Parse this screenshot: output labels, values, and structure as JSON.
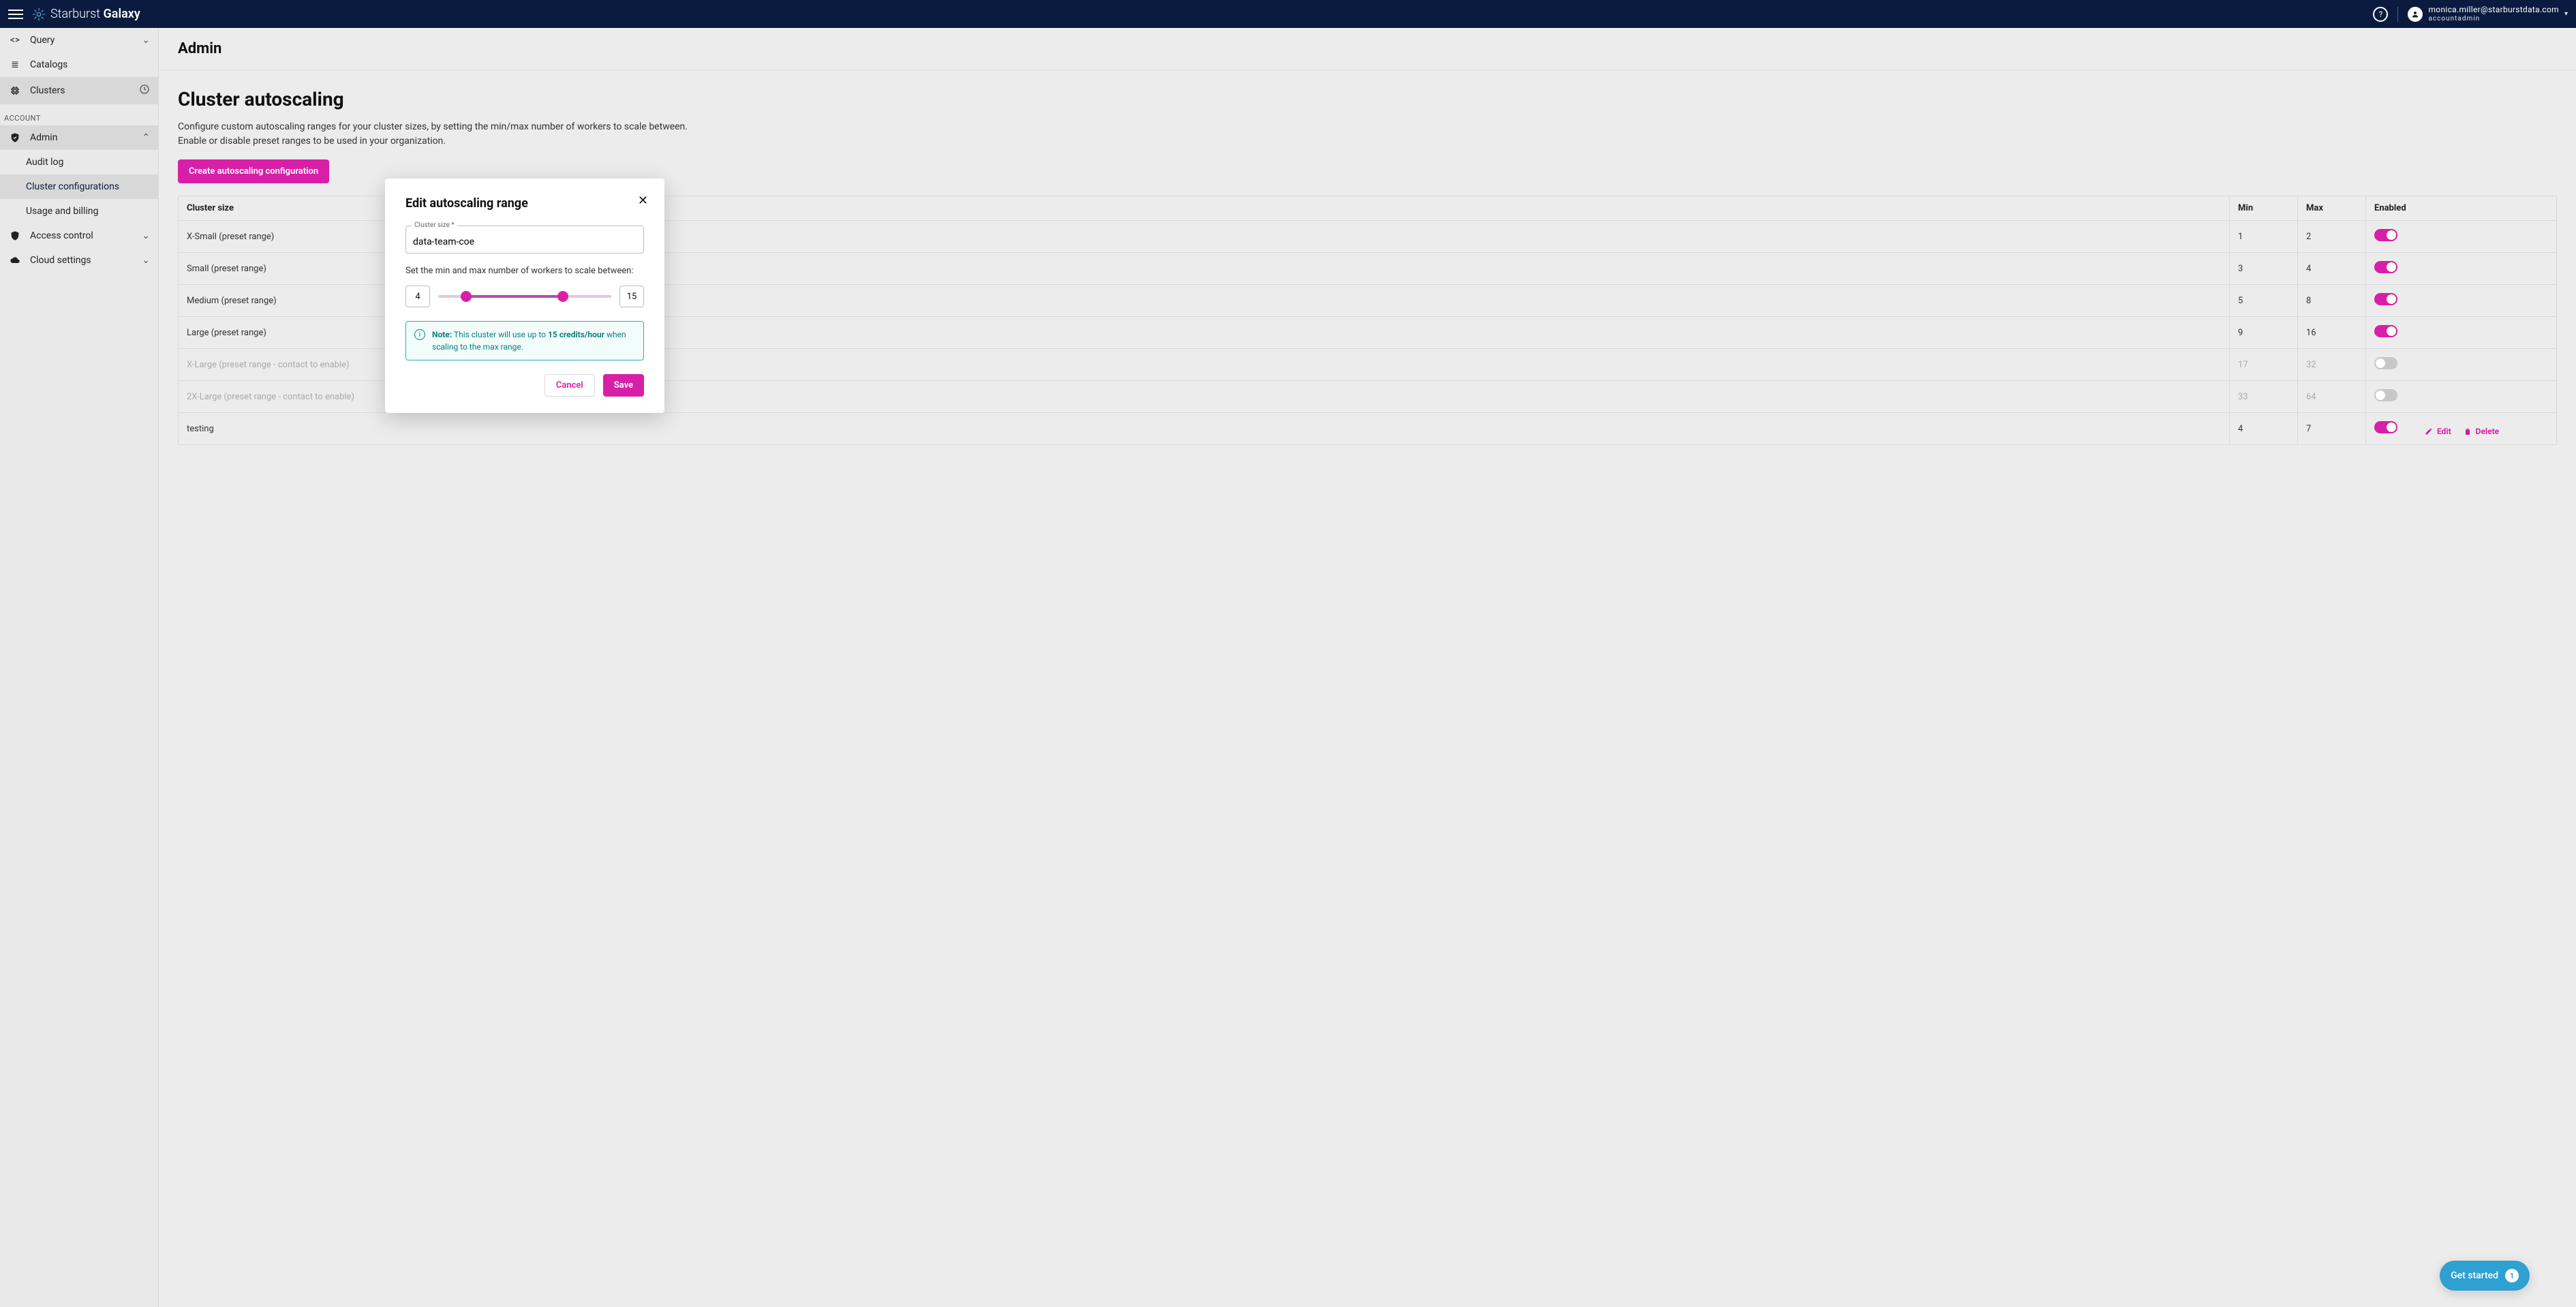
{
  "header": {
    "brand_left": "Starburst",
    "brand_right": "Galaxy",
    "email": "monica.miller@starburstdata.com",
    "role": "accountadmin"
  },
  "sidebar": {
    "top": [
      {
        "label": "Query",
        "icon": "<>",
        "expand": true
      },
      {
        "label": "Catalogs",
        "icon": "≡"
      },
      {
        "label": "Clusters",
        "icon": "⛶",
        "trailing": "clock"
      }
    ],
    "account_label": "ACCOUNT",
    "admin_label": "Admin",
    "admin_children": [
      {
        "label": "Audit log"
      },
      {
        "label": "Cluster configurations",
        "selected": true
      },
      {
        "label": "Usage and billing"
      }
    ],
    "access_control": "Access control",
    "cloud_settings": "Cloud settings"
  },
  "breadcrumb": "Admin",
  "page": {
    "title": "Cluster autoscaling",
    "desc1": "Configure custom autoscaling ranges for your cluster sizes, by setting the min/max number of workers to scale between.",
    "desc2": "Enable or disable preset ranges to be used in your organization.",
    "create_btn": "Create autoscaling configuration",
    "columns": {
      "size": "Cluster size",
      "min": "Min",
      "max": "Max",
      "enabled": "Enabled"
    },
    "rows": [
      {
        "size": "X-Small (preset range)",
        "min": "1",
        "max": "2",
        "enabled": true
      },
      {
        "size": "Small (preset range)",
        "min": "3",
        "max": "4",
        "enabled": true
      },
      {
        "size": "Medium (preset range)",
        "min": "5",
        "max": "8",
        "enabled": true
      },
      {
        "size": "Large (preset range)",
        "min": "9",
        "max": "16",
        "enabled": true
      },
      {
        "size": "X-Large (preset range - contact to enable)",
        "min": "17",
        "max": "32",
        "enabled": false,
        "disabled": true
      },
      {
        "size": "2X-Large (preset range - contact to enable)",
        "min": "33",
        "max": "64",
        "enabled": false,
        "disabled": true
      },
      {
        "size": "testing",
        "min": "4",
        "max": "7",
        "enabled": true,
        "actions": true
      }
    ],
    "edit_label": "Edit",
    "delete_label": "Delete"
  },
  "modal": {
    "title": "Edit autoscaling range",
    "field_label": "Cluster size *",
    "field_value": "data-team-coe",
    "helper": "Set the min and max number of workers to scale between:",
    "min": "4",
    "max": "15",
    "note_label": "Note:",
    "note_prefix": "This cluster will use up to ",
    "note_bold": "15 credits/hour",
    "note_suffix": " when scaling to the max range.",
    "cancel": "Cancel",
    "save": "Save"
  },
  "get_started": {
    "label": "Get started",
    "badge": "1"
  }
}
